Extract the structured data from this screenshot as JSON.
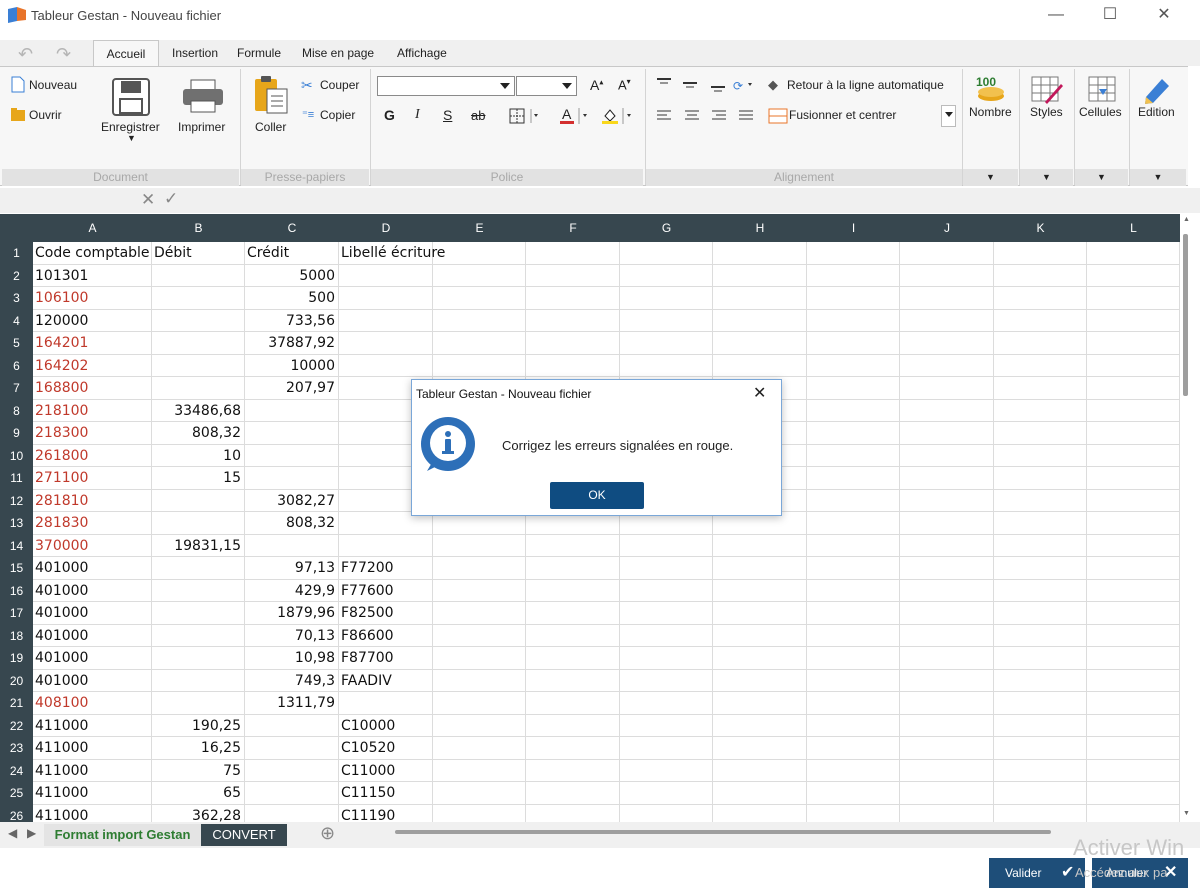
{
  "window": {
    "title": "Tableur Gestan - Nouveau fichier",
    "minimize": "—",
    "maximize": "☐",
    "close": "✕"
  },
  "ribbon": {
    "tabs": [
      "Accueil",
      "Insertion",
      "Formule",
      "Mise en page",
      "Affichage"
    ],
    "active_tab": "Accueil",
    "document": {
      "new": "Nouveau",
      "open": "Ouvrir",
      "save": "Enregistrer",
      "print": "Imprimer",
      "group": "Document"
    },
    "clipboard": {
      "paste": "Coller",
      "cut": "Couper",
      "copy": "Copier",
      "group": "Presse-papiers"
    },
    "font": {
      "bold": "G",
      "italic": "I",
      "underline": "S",
      "strike": "ab",
      "group": "Police"
    },
    "alignment": {
      "wrap": "Retour à la ligne automatique",
      "merge": "Fusionner et centrer",
      "group": "Alignement"
    },
    "number": "Nombre",
    "number_icon_text": "100",
    "styles": "Styles",
    "cells": "Cellules",
    "edition": "Edition"
  },
  "formula_bar": {
    "cancel": "✕",
    "confirm": "✓"
  },
  "sheet": {
    "columns": [
      "A",
      "B",
      "C",
      "D",
      "E",
      "F",
      "G",
      "H",
      "I",
      "J",
      "K",
      "L"
    ],
    "rows": [
      {
        "n": "1",
        "a": "Code comptable",
        "b": "Débit",
        "c": "Crédit",
        "d": "Libellé écriture",
        "red": false,
        "header": true
      },
      {
        "n": "2",
        "a": "101301",
        "b": "",
        "c": "5000",
        "d": "",
        "red": false
      },
      {
        "n": "3",
        "a": "106100",
        "b": "",
        "c": "500",
        "d": "",
        "red": true
      },
      {
        "n": "4",
        "a": "120000",
        "b": "",
        "c": "733,56",
        "d": "",
        "red": false
      },
      {
        "n": "5",
        "a": "164201",
        "b": "",
        "c": "37887,92",
        "d": "",
        "red": true
      },
      {
        "n": "6",
        "a": "164202",
        "b": "",
        "c": "10000",
        "d": "",
        "red": true
      },
      {
        "n": "7",
        "a": "168800",
        "b": "",
        "c": "207,97",
        "d": "",
        "red": true
      },
      {
        "n": "8",
        "a": "218100",
        "b": "33486,68",
        "c": "",
        "d": "",
        "red": true
      },
      {
        "n": "9",
        "a": "218300",
        "b": "808,32",
        "c": "",
        "d": "",
        "red": true
      },
      {
        "n": "10",
        "a": "261800",
        "b": "10",
        "c": "",
        "d": "",
        "red": true
      },
      {
        "n": "11",
        "a": "271100",
        "b": "15",
        "c": "",
        "d": "",
        "red": true
      },
      {
        "n": "12",
        "a": "281810",
        "b": "",
        "c": "3082,27",
        "d": "",
        "red": true
      },
      {
        "n": "13",
        "a": "281830",
        "b": "",
        "c": "808,32",
        "d": "",
        "red": true
      },
      {
        "n": "14",
        "a": "370000",
        "b": "19831,15",
        "c": "",
        "d": "",
        "red": true
      },
      {
        "n": "15",
        "a": "401000",
        "b": "",
        "c": "97,13",
        "d": "F77200",
        "red": false
      },
      {
        "n": "16",
        "a": "401000",
        "b": "",
        "c": "429,9",
        "d": "F77600",
        "red": false
      },
      {
        "n": "17",
        "a": "401000",
        "b": "",
        "c": "1879,96",
        "d": "F82500",
        "red": false
      },
      {
        "n": "18",
        "a": "401000",
        "b": "",
        "c": "70,13",
        "d": "F86600",
        "red": false
      },
      {
        "n": "19",
        "a": "401000",
        "b": "",
        "c": "10,98",
        "d": "F87700",
        "red": false
      },
      {
        "n": "20",
        "a": "401000",
        "b": "",
        "c": "749,3",
        "d": "FAADIV",
        "red": false
      },
      {
        "n": "21",
        "a": "408100",
        "b": "",
        "c": "1311,79",
        "d": "",
        "red": true
      },
      {
        "n": "22",
        "a": "411000",
        "b": "190,25",
        "c": "",
        "d": "C10000",
        "red": false
      },
      {
        "n": "23",
        "a": "411000",
        "b": "16,25",
        "c": "",
        "d": "C10520",
        "red": false
      },
      {
        "n": "24",
        "a": "411000",
        "b": "75",
        "c": "",
        "d": "C11000",
        "red": false
      },
      {
        "n": "25",
        "a": "411000",
        "b": "65",
        "c": "",
        "d": "C11150",
        "red": false
      },
      {
        "n": "26",
        "a": "411000",
        "b": "362,28",
        "c": "",
        "d": "C11190",
        "red": false
      }
    ],
    "tabs": [
      "Format import Gestan",
      "CONVERT"
    ],
    "add_sheet": "⊕"
  },
  "dialog": {
    "title": "Tableur Gestan - Nouveau fichier",
    "message": "Corrigez les erreurs signalées en rouge.",
    "ok": "OK",
    "close": "✕"
  },
  "footer": {
    "validate": "Valider",
    "cancel": "Annuler"
  },
  "watermark": {
    "line1": "Activer Win",
    "line2": "Accédez aux pa"
  },
  "colors": {
    "header_dark": "#37474f",
    "error_red": "#c0392b",
    "button_blue": "#1e4e79",
    "active_sheet_green": "#2e7d32"
  }
}
